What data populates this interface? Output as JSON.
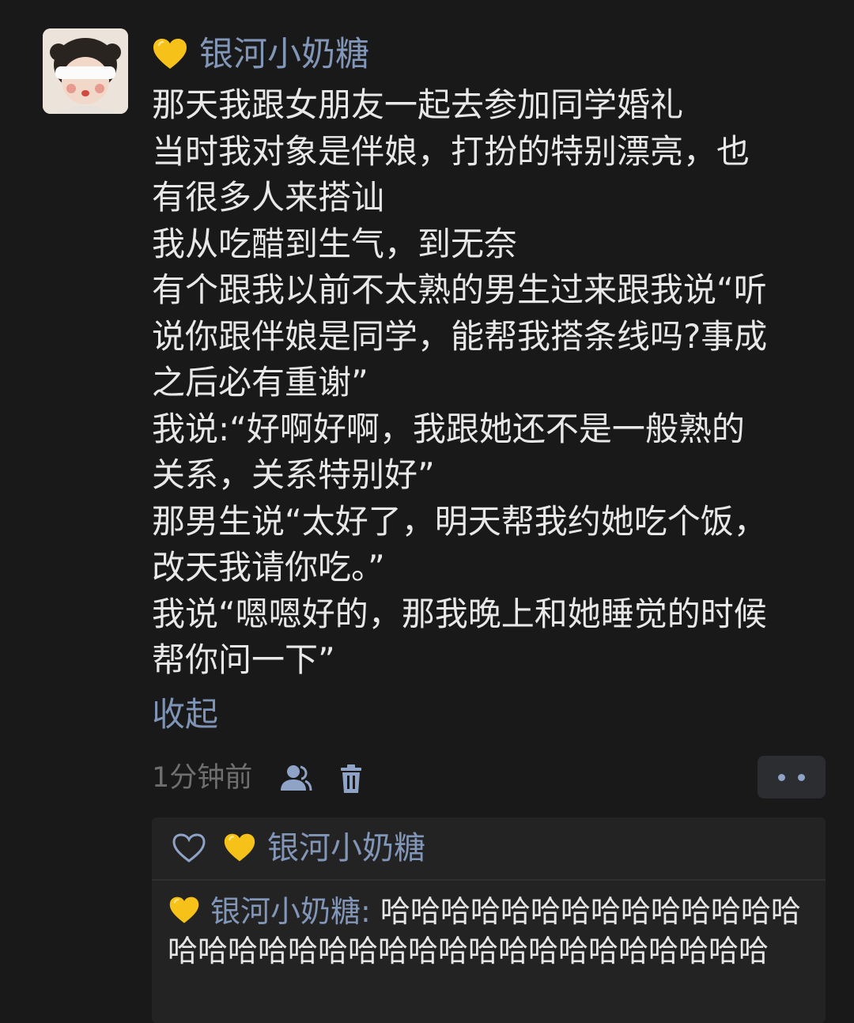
{
  "post": {
    "author_name": "银河小奶糖",
    "author_badge_icon": "yellow-heart-icon",
    "body_lines": [
      "那天我跟女朋友一起去参加同学婚礼",
      "当时我对象是伴娘，打扮的特别漂亮，也",
      "有很多人来搭讪",
      "我从吃醋到生气，到无奈",
      "有个跟我以前不太熟的男生过来跟我说“听",
      "说你跟伴娘是同学，能帮我搭条线吗?事成",
      "之后必有重谢”",
      "我说:“好啊好啊，我跟她还不是一般熟的",
      "关系，关系特别好”",
      "那男生说“太好了，明天帮我约她吃个饭，",
      "改天我请你吃。”",
      "我说“嗯嗯好的，那我晚上和她睡觉的时候",
      "帮你问一下”"
    ],
    "collapse_label": "收起",
    "timestamp": "1分钟前"
  },
  "interactions": {
    "likes": [
      "银河小奶糖"
    ],
    "comments": [
      {
        "author": "银河小奶糖",
        "separator": ": ",
        "text": "哈哈哈哈哈哈哈哈哈哈哈哈哈哈哈哈哈哈哈哈哈哈哈哈哈哈哈哈哈哈哈哈哈哈"
      }
    ]
  },
  "colors": {
    "background": "#191919",
    "name_link": "#8296b8",
    "body_text": "#e8e8e8",
    "muted": "#6f6f6f",
    "panel": "#232323",
    "heart": "#f6c21a"
  }
}
